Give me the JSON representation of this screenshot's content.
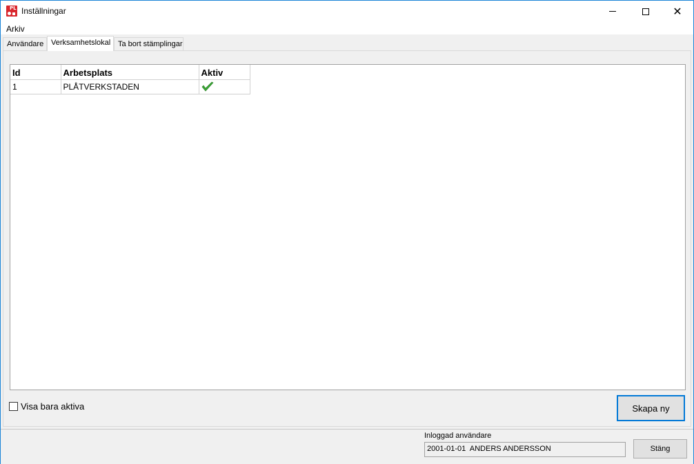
{
  "window": {
    "title": "Inställningar",
    "app_icon_text": "PL"
  },
  "menu": {
    "items": [
      "Arkiv"
    ]
  },
  "tabs": [
    {
      "label": "Användare",
      "active": false
    },
    {
      "label": "Verksamhetslokal",
      "active": true
    },
    {
      "label": "Ta bort stämplingar",
      "active": false
    }
  ],
  "grid": {
    "columns": [
      "Id",
      "Arbetsplats",
      "Aktiv"
    ],
    "rows": [
      {
        "id": "1",
        "arbetsplats": "PLÅTVERKSTADEN",
        "aktiv_icon": "check-icon"
      }
    ]
  },
  "filter": {
    "label": "Visa bara aktiva",
    "checked": false
  },
  "buttons": {
    "create": "Skapa ny",
    "close": "Stäng"
  },
  "status": {
    "label": "Inloggad användare",
    "value": "2001-01-01  ANDERS ANDERSSON"
  },
  "colors": {
    "accent": "#0078d7",
    "window_border": "#1883d7",
    "check_green": "#3aa635",
    "app_icon": "#d9262c"
  }
}
